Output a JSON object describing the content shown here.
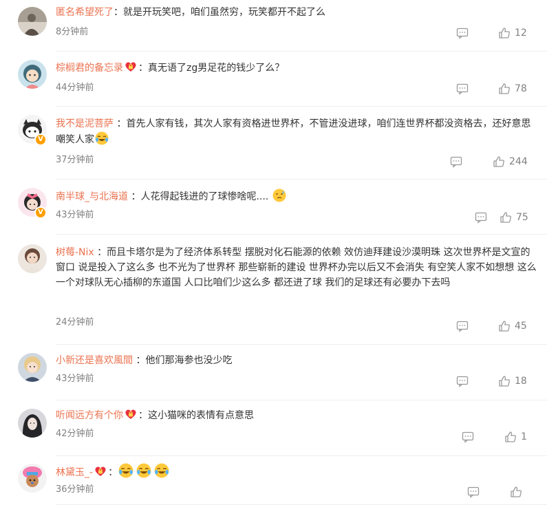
{
  "colors": {
    "username": "#eb7350",
    "text": "#333333",
    "meta": "#808080"
  },
  "comments": [
    {
      "username": "匿名希望死了",
      "badge": null,
      "separator": "：",
      "text": "就是开玩笑吧，咱们虽然穷，玩笑都开不起了么",
      "time": "8分钟前",
      "likes": "12",
      "verified": false,
      "avatar": "avatar-photo"
    },
    {
      "username": "棕榈君的备忘录",
      "badge": "heart-lock-icon",
      "separator": "：",
      "text": "真无语了zg男足花的钱少了么？",
      "time": "44分钟前",
      "likes": "78",
      "verified": false,
      "avatar": "avatar-cartoon-girl"
    },
    {
      "username": "我不是泥菩萨",
      "badge": null,
      "separator": " ：",
      "text": "首先人家有钱，其次人家有资格进世界杯，不管进没进球，咱们连世界杯都没资格去，还好意思嘲笑人家",
      "emoji": "laugh-cry-emoji",
      "time": "37分钟前",
      "likes": "244",
      "verified": true,
      "avatar": "avatar-cartoon-cat"
    },
    {
      "username": "南半球_与北海道",
      "badge": null,
      "separator": " ：",
      "text": "人花得起钱进的了球惨啥呢.... ",
      "emoji": "sweat-emoji",
      "time": "43分钟前",
      "likes": "75",
      "verified": true,
      "avatar": "avatar-girl-bow"
    },
    {
      "username": "树莓-Nix",
      "badge": null,
      "separator": " ：",
      "text": "而且卡塔尔是为了经济体系转型 摆脱对化石能源的依赖 效仿迪拜建设沙漠明珠 这次世界杯是文宣的窗口 说是投入了这么多 也不光为了世界杯 那些崭新的建设 世界杯办完以后又不会消失 有空笑人家不如想想 这么一个对球队无心插柳的东道国 人口比咱们少这么多 都还进了球 我们的足球还有必要办下去吗",
      "time": "24分钟前",
      "likes": "45",
      "verified": false,
      "avatar": "avatar-child"
    },
    {
      "username": "小新还是喜欢風間",
      "badge": null,
      "separator": " ：",
      "text": "他们那海参也没少吃",
      "time": "43分钟前",
      "likes": "18",
      "verified": false,
      "avatar": "avatar-blonde"
    },
    {
      "username": "听闻远方有个你",
      "badge": "heart-lock-icon",
      "separator": "：",
      "text": "这小猫咪的表情有点意思",
      "time": "42分钟前",
      "likes": "1",
      "verified": false,
      "avatar": "avatar-dark-hair"
    },
    {
      "username": "林黛玉_-",
      "badge": "heart-lock-icon",
      "separator": "：",
      "text": "",
      "emoji_count": 3,
      "emoji": "laugh-cry-emoji",
      "time": "36分钟前",
      "likes": "",
      "verified": false,
      "avatar": "avatar-cartoon-chopper"
    }
  ],
  "icons": {
    "reply": "reply-icon",
    "like": "like-icon",
    "verified": "verified-v-icon"
  }
}
